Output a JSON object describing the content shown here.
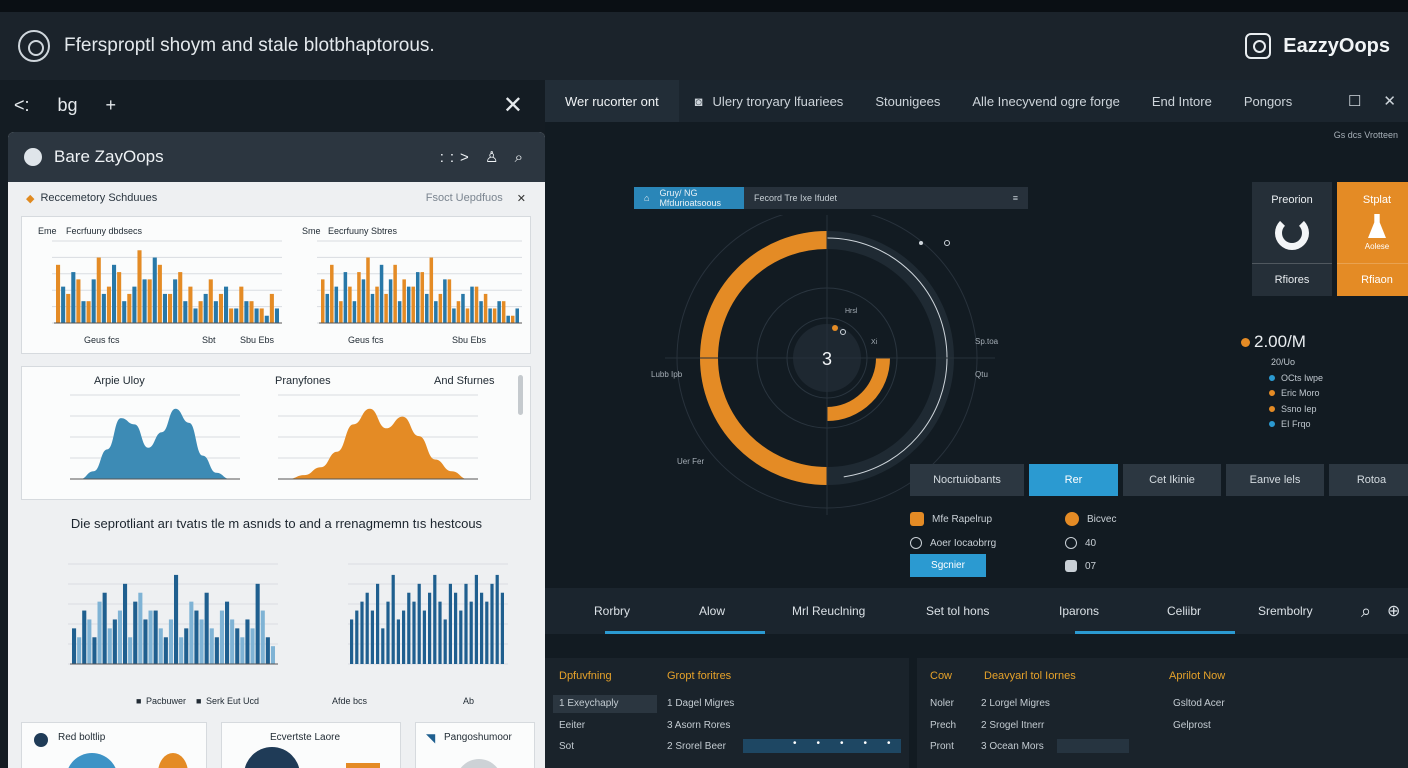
{
  "window": {
    "title": "Ffersproptl shoym and stale blotbhaptorous.",
    "brand": "EazzyOops"
  },
  "left_tabs": {
    "back": "<:",
    "tab": "bg",
    "add": "+",
    "close": "✕"
  },
  "left_card": {
    "title": "Bare ZayOops",
    "tools": "::> ♙ ⌕",
    "section_title": "Reccemetory Schduues",
    "section_right": "Fsoct Uepdfuos",
    "bar_panel_1": {
      "title": "Fecrfuuny dbdsecs",
      "side": "Eme",
      "x_labels": [
        "Geus fcs",
        "Sbt",
        "Sbu Ebs"
      ]
    },
    "bar_panel_2": {
      "title": "Eecrfuuny Sbtres",
      "side": "Sme",
      "x_labels": [
        "Geus fcs",
        "Sbu Ebs"
      ]
    },
    "curve_titles": [
      "Arpie Uloy",
      "Pranyfones",
      "And Sfurnes"
    ],
    "curve_y_ticks": [
      "10000",
      "150",
      "100",
      "0",
      "0"
    ],
    "curve_y2_ticks": [
      "00",
      "00",
      "00",
      "0"
    ],
    "curve_right_ticks": [
      "1.00%",
      "3.00%",
      "1.00%",
      "30.8%",
      "1.00%"
    ],
    "middle_caption": "Die seprotliant arı tvatıs tle m asnıds to and a rrenagmemn tıs hestcous",
    "bottom_bar_legend": [
      "Pacbuwer",
      "Serk Eut Ucd"
    ],
    "bottom_bar_x": [
      "0",
      "0",
      "1",
      "b",
      "0"
    ],
    "bottom_bar2_x": [
      "Afde bcs",
      "Ab"
    ],
    "bottom_cards": [
      "Red boltlip",
      "Ecvertste Laore",
      "Pangoshumoor"
    ]
  },
  "right_tabs": {
    "items": [
      "Wer rucorter ont",
      "Ulery troryary lfuariees",
      "Stounigees",
      "Alle Inecyvend ogre forge",
      "End Intore",
      "Pongors"
    ],
    "tinyhdr": "Gs dcs   Vrotteen"
  },
  "breadcrumb": {
    "a": "Gruy/  NG Mfdurioatsoous",
    "b": "Fecord Tre Ixe Ifudet"
  },
  "gauge": {
    "center": "3",
    "labels": [
      "Lubb Ipb",
      "Uer Fer",
      "Hrsl",
      "Sp.toa",
      "Qtu",
      "Xi"
    ]
  },
  "cards": [
    {
      "top": "Preorion",
      "bottom": "Rfiores"
    },
    {
      "top": "Stplat",
      "mid": "Aolese",
      "bottom": "Rfiaon"
    }
  ],
  "stat": {
    "value": "2.00/M",
    "sub": "20/Uo",
    "legend": [
      {
        "label": "OCts Iwpe",
        "color": "#2b9ad1"
      },
      {
        "label": "Eric Moro",
        "color": "#e48b25"
      },
      {
        "label": "Ssno Iep",
        "color": "#e48b25"
      },
      {
        "label": "EI Frqo",
        "color": "#2b9ad1"
      }
    ]
  },
  "segments": [
    "Nocrtuiobants",
    "Rer",
    "Cet Ikinie",
    "Eanve lels",
    "Rotoa"
  ],
  "options": [
    {
      "label": "Mfe Rapelrup",
      "color": "#e48b25"
    },
    {
      "label": "Bicvec",
      "color": "#e48b25"
    },
    {
      "label": "Aoer Iocaobrrg",
      "color": "#c9d0d6"
    },
    {
      "label": "40",
      "color": "#c9d0d6"
    },
    {
      "label": "07",
      "color": "#c9d0d6"
    }
  ],
  "button": "Sgcnier",
  "navbar": [
    "Rorbry",
    "Alow",
    "Mrl Reuclning",
    "Set tol hons",
    "Iparons",
    "Celiibr",
    "Srembolry"
  ],
  "table1": {
    "headers": [
      "Dpfuvfning",
      "Gropt foritres"
    ],
    "rows": [
      [
        "1 Exeychaply",
        "1 Dagel Migres"
      ],
      [
        "Eeiter",
        "3 Asorn Rores"
      ],
      [
        "Sot",
        "2 Srorel Beer"
      ]
    ]
  },
  "table2": {
    "headers": [
      "Cow",
      "Deavyarl tol Iornes",
      "Aprilot Now"
    ],
    "rows": [
      [
        "Noler",
        "2 Lorgel Migres",
        "Gsltod Acer"
      ],
      [
        "Prech",
        "2 Srogel Itnerr",
        "Gelprost"
      ],
      [
        "Pront",
        "3 Ocean Mors",
        ""
      ]
    ]
  },
  "chart_data": [
    {
      "type": "bar",
      "series": [
        {
          "values": [
            8,
            4,
            6,
            3,
            9,
            5,
            7,
            4,
            10,
            6,
            8,
            4,
            7,
            5,
            3,
            6,
            4,
            2,
            5,
            3,
            2,
            4
          ]
        },
        {
          "values": [
            5,
            7,
            3,
            6,
            4,
            8,
            3,
            5,
            6,
            9,
            4,
            6,
            3,
            2,
            4,
            3,
            5,
            2,
            3,
            2,
            1,
            2
          ]
        }
      ]
    },
    {
      "type": "bar",
      "series": [
        {
          "values": [
            6,
            8,
            3,
            5,
            7,
            9,
            5,
            4,
            8,
            6,
            5,
            7,
            9,
            4,
            6,
            3,
            2,
            5,
            4,
            2,
            3,
            1
          ]
        },
        {
          "values": [
            4,
            5,
            7,
            3,
            6,
            4,
            8,
            6,
            3,
            5,
            7,
            4,
            3,
            6,
            2,
            4,
            5,
            3,
            2,
            3,
            1,
            2
          ]
        }
      ]
    },
    {
      "type": "area",
      "values": [
        0,
        10,
        38,
        78,
        70,
        40,
        60,
        90,
        72,
        30,
        8,
        0
      ]
    },
    {
      "type": "area",
      "values": [
        0,
        5,
        15,
        35,
        70,
        90,
        65,
        80,
        55,
        25,
        10,
        0
      ]
    },
    {
      "type": "bar",
      "series": [
        {
          "values": [
            4,
            6,
            3,
            8,
            5,
            9,
            7,
            5,
            6,
            3,
            10,
            4,
            6,
            8,
            3,
            7,
            4,
            5,
            9,
            3
          ]
        },
        {
          "values": [
            3,
            5,
            7,
            4,
            6,
            3,
            8,
            6,
            4,
            5,
            3,
            7,
            5,
            4,
            6,
            5,
            3,
            4,
            6,
            2
          ]
        }
      ]
    },
    {
      "type": "bar",
      "values": [
        5,
        6,
        7,
        8,
        6,
        9,
        4,
        7,
        10,
        5,
        6,
        8,
        7,
        9,
        6,
        8,
        10,
        7,
        5,
        9,
        8,
        6,
        9,
        7,
        10,
        8,
        7,
        9,
        10,
        8
      ]
    }
  ]
}
